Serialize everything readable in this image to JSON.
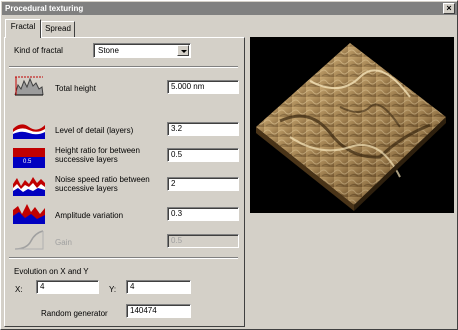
{
  "window": {
    "title": "Procedural texturing",
    "close_label": "×"
  },
  "tabs": [
    {
      "label": "Fractal",
      "active": true
    },
    {
      "label": "Spread",
      "active": false
    }
  ],
  "kind_of_fractal": {
    "label": "Kind of fractal",
    "value": "Stone"
  },
  "params": {
    "total_height": {
      "label": "Total height",
      "value": "5.000 nm"
    },
    "level_of_detail": {
      "label": "Level of detail (layers)",
      "value": "3.2"
    },
    "height_ratio": {
      "label_line1": "Height ratio for between",
      "label_line2": "successive layers",
      "value": "0.5"
    },
    "noise_speed": {
      "label_line1": "Noise speed ratio between",
      "label_line2": "successive layers",
      "value": "2"
    },
    "amplitude": {
      "label": "Amplitude variation",
      "value": "0.3"
    },
    "gain": {
      "label": "Gain",
      "value": "0.5"
    }
  },
  "evolution": {
    "label": "Evolution on X and Y",
    "x_label": "X:",
    "x_value": "4",
    "y_label": "Y:",
    "y_value": "4"
  },
  "random": {
    "label": "Random generator",
    "value": "140474"
  },
  "colors": {
    "title_bar": "#808080",
    "panel": "#d4d0c8",
    "terrain": "#a08050"
  }
}
